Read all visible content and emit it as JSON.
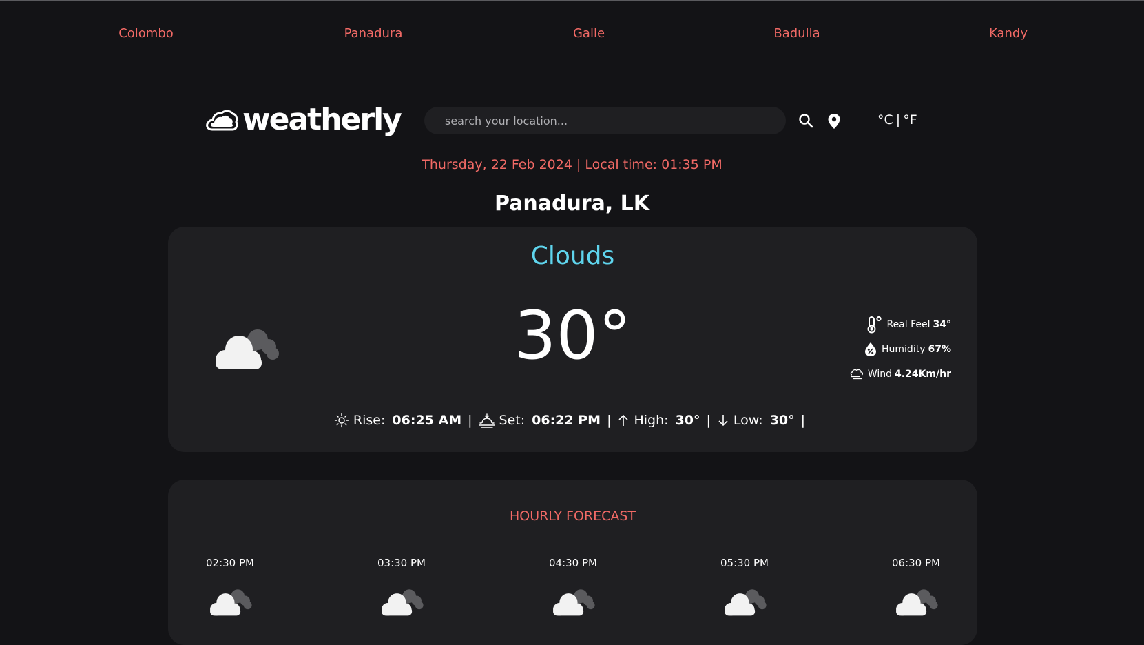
{
  "cities": [
    "Colombo",
    "Panadura",
    "Galle",
    "Badulla",
    "Kandy"
  ],
  "logo": {
    "text": "weatherly"
  },
  "search": {
    "placeholder": "search your location..."
  },
  "units": {
    "celsius": "°C",
    "separator": "|",
    "fahrenheit": "°F"
  },
  "datetime": "Thursday, 22 Feb 2024 | Local time: 01:35 PM",
  "location": "Panadura, LK",
  "current": {
    "condition": "Clouds",
    "icon": "clouds-icon",
    "temperature": "30°",
    "real_feel_label": "Real Feel",
    "real_feel_value": "34°",
    "humidity_label": "Humidity",
    "humidity_value": "67%",
    "wind_label": "Wind",
    "wind_value": "4.24Km/hr",
    "rise_label": "Rise:",
    "rise_value": "06:25 AM",
    "set_label": "Set:",
    "set_value": "06:22 PM",
    "high_label": "High:",
    "high_value": "30°",
    "low_label": "Low:",
    "low_value": "30°",
    "separator": "|"
  },
  "hourly": {
    "title": "HOURLY FORECAST",
    "items": [
      {
        "time": "02:30 PM",
        "icon": "clouds-icon"
      },
      {
        "time": "03:30 PM",
        "icon": "clouds-icon"
      },
      {
        "time": "04:30 PM",
        "icon": "clouds-icon"
      },
      {
        "time": "05:30 PM",
        "icon": "clouds-icon"
      },
      {
        "time": "06:30 PM",
        "icon": "clouds-icon"
      }
    ]
  },
  "colors": {
    "background": "#131316",
    "card": "#1f1f22",
    "accent": "#f26a66",
    "condition": "#5fd5ee"
  }
}
